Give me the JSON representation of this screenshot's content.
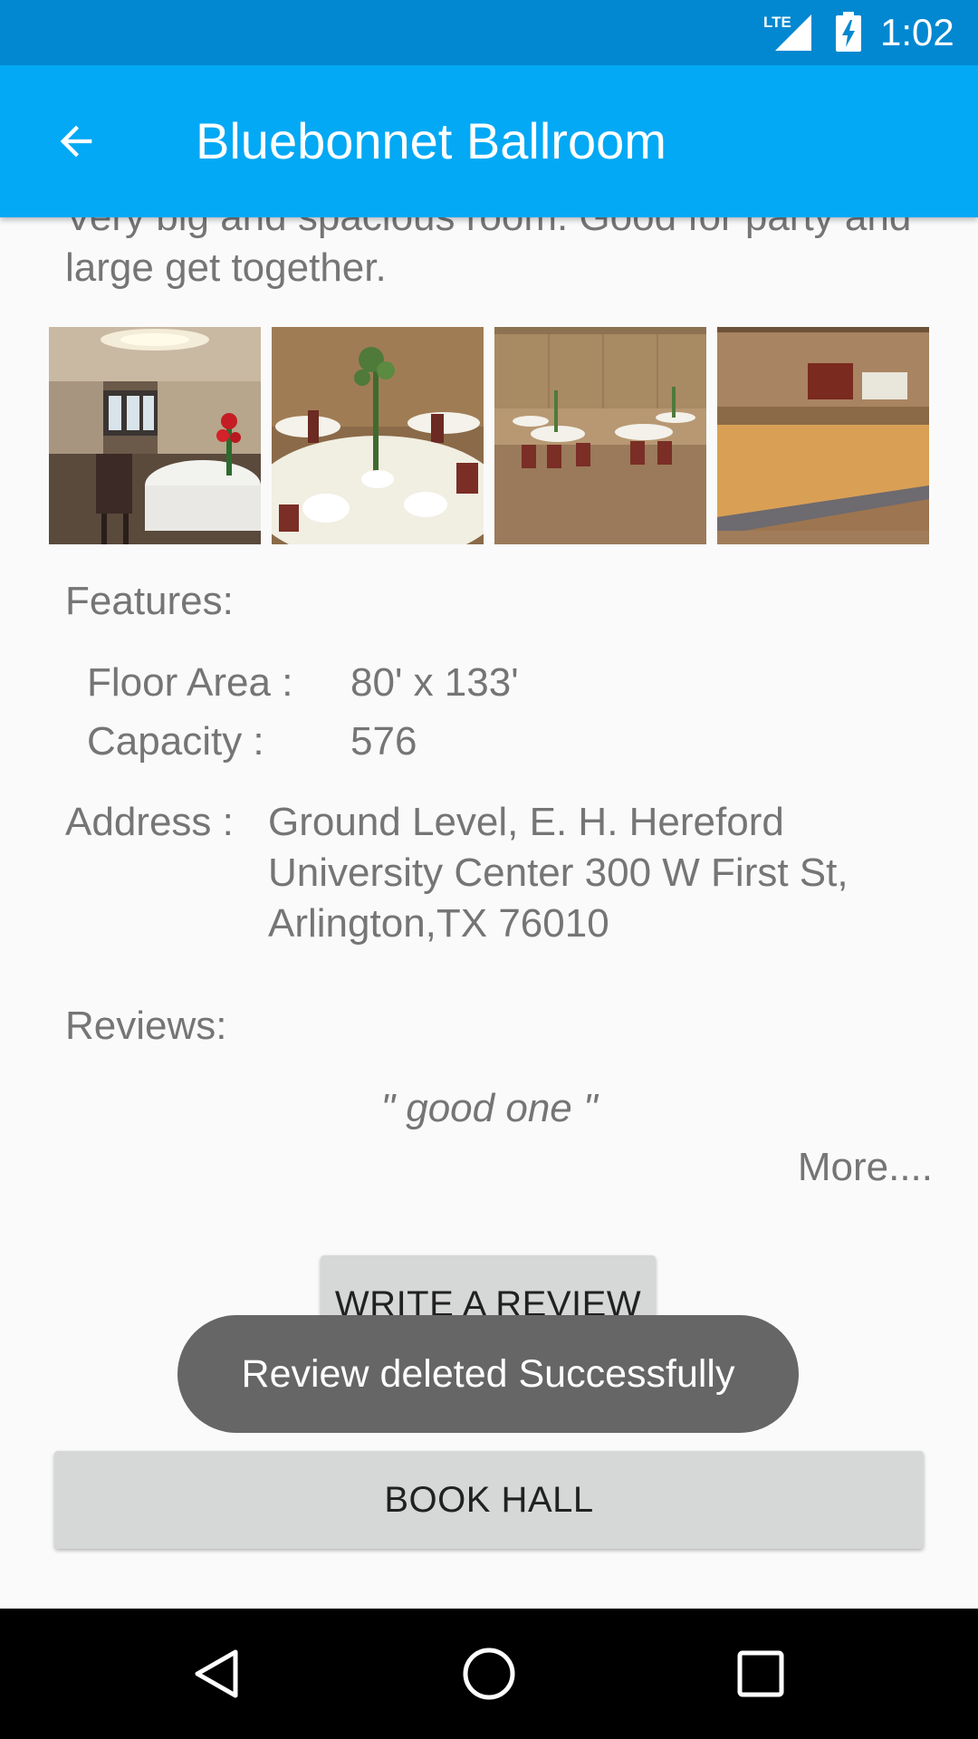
{
  "status_bar": {
    "network": "LTE",
    "time": "1:02",
    "icons": [
      "lte-signal-icon",
      "battery-charging-icon"
    ]
  },
  "app_bar": {
    "title": "Bluebonnet Ballroom",
    "back_icon": "arrow-back-icon"
  },
  "hall": {
    "description": "Very big and spacious room. Good for party and large get together.",
    "photos": [
      "ballroom-table-setting-photo",
      "banquet-table-centerpiece-photo",
      "banquet-hall-tables-photo",
      "ballroom-dance-floor-photo"
    ],
    "features_heading": "Features:",
    "features": [
      {
        "label": "Floor Area :",
        "value": "80' x 133'"
      },
      {
        "label": "Capacity :",
        "value": "576"
      }
    ],
    "address_label": "Address :",
    "address_value": "Ground Level, E. H. Hereford University Center 300 W First St, Arlington,TX 76010",
    "reviews_heading": "Reviews:",
    "review_quote": "\" good one \"",
    "more_link": "More...."
  },
  "actions": {
    "write_review": "WRITE A REVIEW",
    "book_hall": "BOOK HALL"
  },
  "toast": {
    "message": "Review deleted Successfully"
  },
  "nav_bar": {
    "icons": [
      "back-triangle-icon",
      "home-circle-icon",
      "recents-square-icon"
    ]
  },
  "colors": {
    "status_bar": "#0288d1",
    "app_bar": "#03a9f4",
    "background": "#fafafa",
    "text": "#757575",
    "button": "#d6d7d7",
    "toast": "#666666"
  }
}
